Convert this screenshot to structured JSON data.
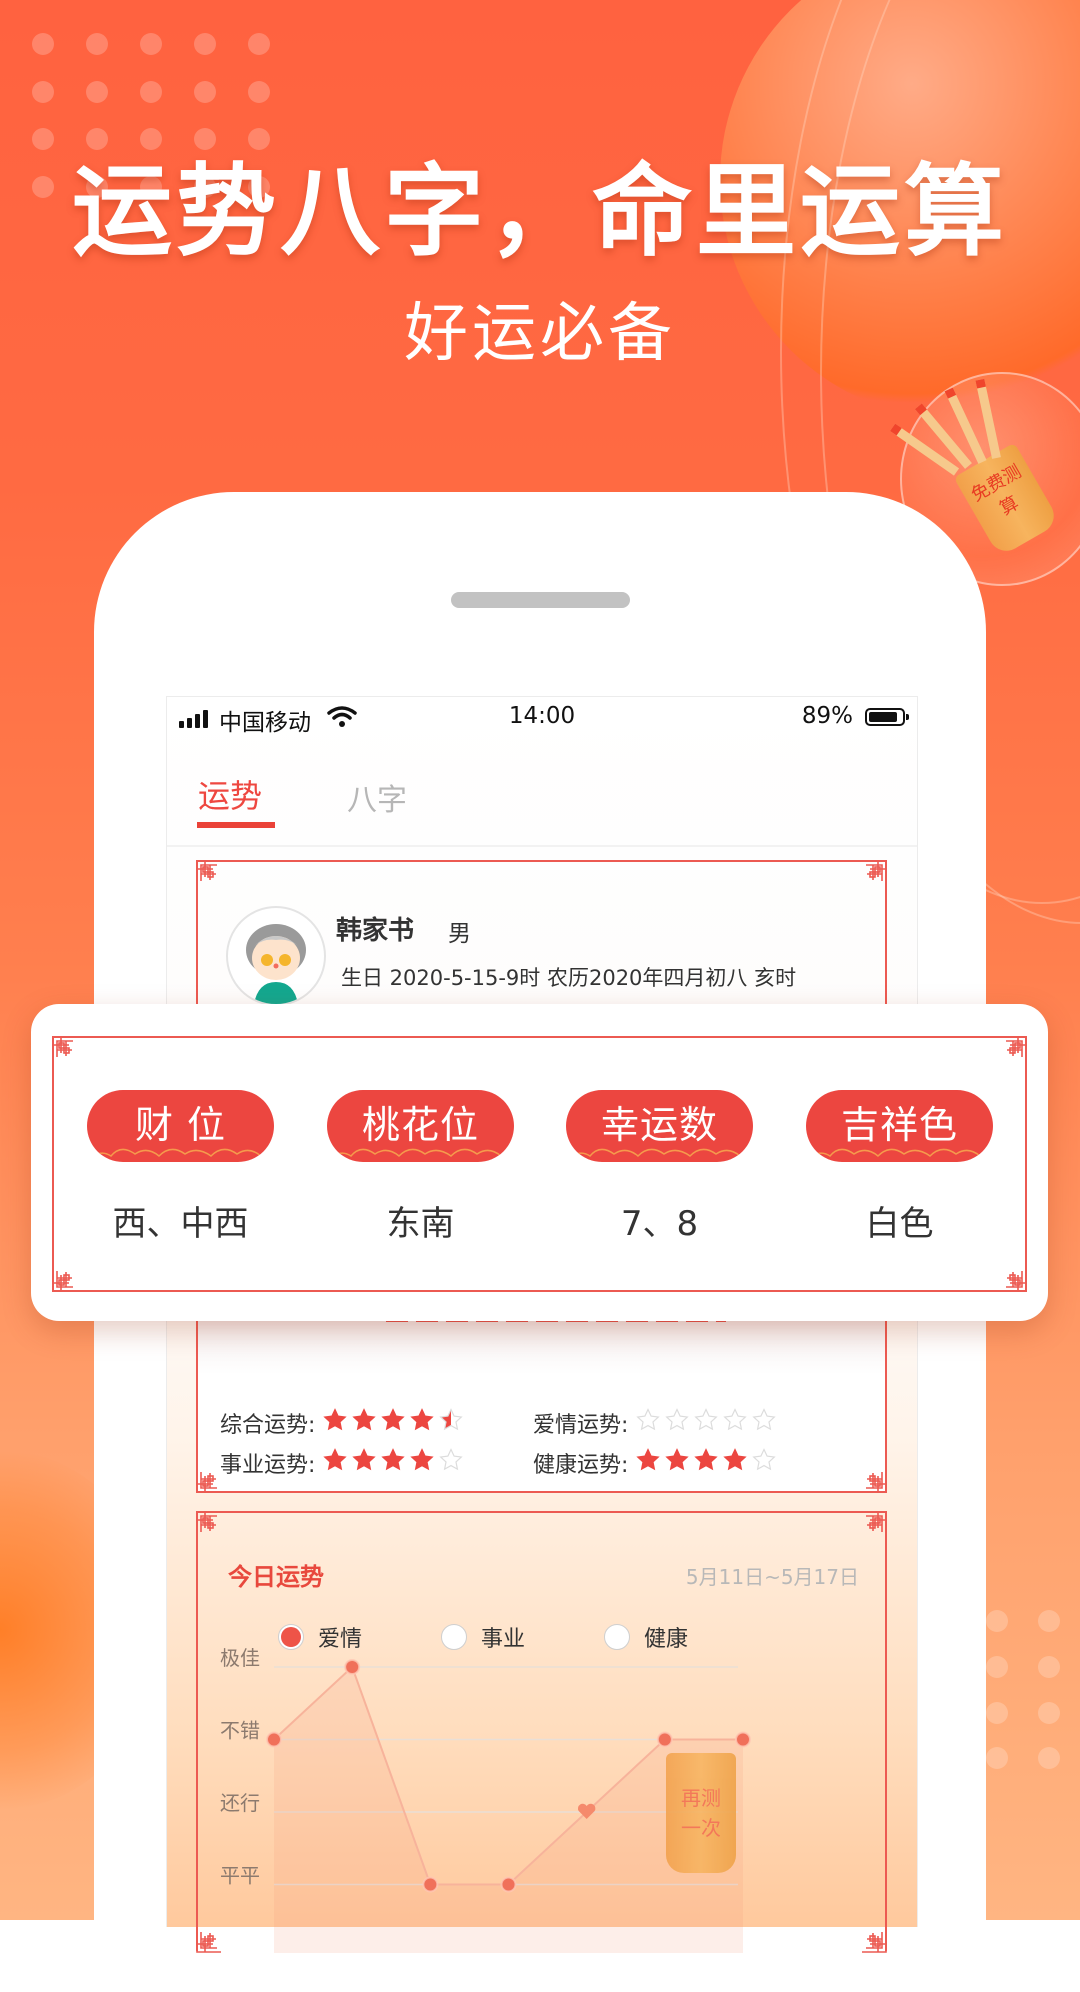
{
  "promo": {
    "headline": "运势八字，命里运算",
    "subheadline": "好运必备",
    "bubble_badge": "免费测算",
    "retry_badge": "再测一次"
  },
  "status_bar": {
    "carrier": "中国移动",
    "time": "14:00",
    "battery_percent": "89%",
    "battery_level": 0.89
  },
  "tabs": [
    {
      "label": "运势",
      "active": true
    },
    {
      "label": "八字",
      "active": false
    }
  ],
  "profile": {
    "name": "韩家书",
    "gender": "男",
    "birth_info": "生日 2020-5-15-9时   农历2020年四月初八 亥时"
  },
  "lucky_items": [
    {
      "label": "财 位",
      "value": "西、中西"
    },
    {
      "label": "桃花位",
      "value": "东南"
    },
    {
      "label": "幸运数",
      "value": "7、8"
    },
    {
      "label": "吉祥色",
      "value": "白色"
    }
  ],
  "fortune_ratings": [
    {
      "label": "综合运势:",
      "stars": 4.5,
      "max": 5
    },
    {
      "label": "爱情运势:",
      "stars": 0,
      "max": 5
    },
    {
      "label": "事业运势:",
      "stars": 4,
      "max": 5
    },
    {
      "label": "健康运势:",
      "stars": 4,
      "max": 5
    }
  ],
  "today": {
    "title": "今日运势",
    "date_range": "5月11日~5月17日",
    "options": [
      {
        "label": "爱情",
        "selected": true
      },
      {
        "label": "事业",
        "selected": false
      },
      {
        "label": "健康",
        "selected": false
      }
    ]
  },
  "colors": {
    "accent_red": "#ec4640",
    "brand_orange": "#ff6a42",
    "star_empty": "#dcdcdc"
  },
  "chart_data": {
    "type": "line",
    "title": "今日运势",
    "levels": [
      "平平",
      "还行",
      "不错",
      "极佳"
    ],
    "ylim": [
      1,
      4
    ],
    "series": [
      {
        "name": "爱情",
        "values": [
          3,
          4,
          1,
          1,
          2,
          3,
          3
        ],
        "marker_special_index": 4
      }
    ],
    "grid": true,
    "legend": "none"
  }
}
